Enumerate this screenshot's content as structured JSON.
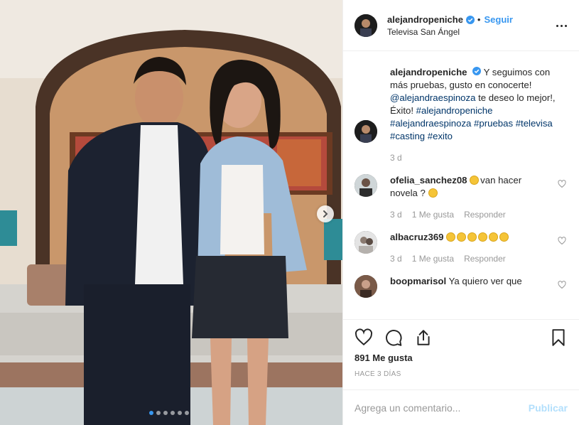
{
  "post": {
    "author": "alejandropeniche",
    "follow_label": "Seguir",
    "location": "Televisa San Ángel",
    "caption_text": "Y seguimos con más pruebas, gusto en conocerte!",
    "caption_mention": "@alejandraespinoza",
    "caption_text2": "te deseo lo mejor!, Éxito!",
    "caption_tags": "#alejandropeniche #alejandraespinoza #pruebas #televisa #casting #exito",
    "caption_age": "3 d",
    "likes": "891 Me gusta",
    "posted": "HACE 3 DÍAS",
    "carousel_count": 6,
    "carousel_active": 0
  },
  "comments": [
    {
      "user": "ofelia_sanchez08",
      "text_before": "",
      "text": "van hacer novela ?",
      "age": "3 d",
      "likes": "1 Me gusta",
      "reply": "Responder"
    },
    {
      "user": "albacruz369",
      "text": "",
      "age": "3 d",
      "likes": "1 Me gusta",
      "reply": "Responder"
    },
    {
      "user": "boopmarisol",
      "text": "Ya quiero ver que"
    }
  ],
  "composer": {
    "placeholder": "Agrega un comentario...",
    "publish_label": "Publicar"
  },
  "icons": {
    "like": "heart-icon",
    "comment": "comment-icon",
    "share": "share-icon",
    "save": "bookmark-icon",
    "more": "more-options-icon",
    "verified": "verified-badge-icon",
    "next": "chevron-right-icon"
  },
  "colors": {
    "link": "#3897f0",
    "hashtag": "#003569",
    "muted": "#999999",
    "publish_disabled": "#b2dffc"
  }
}
